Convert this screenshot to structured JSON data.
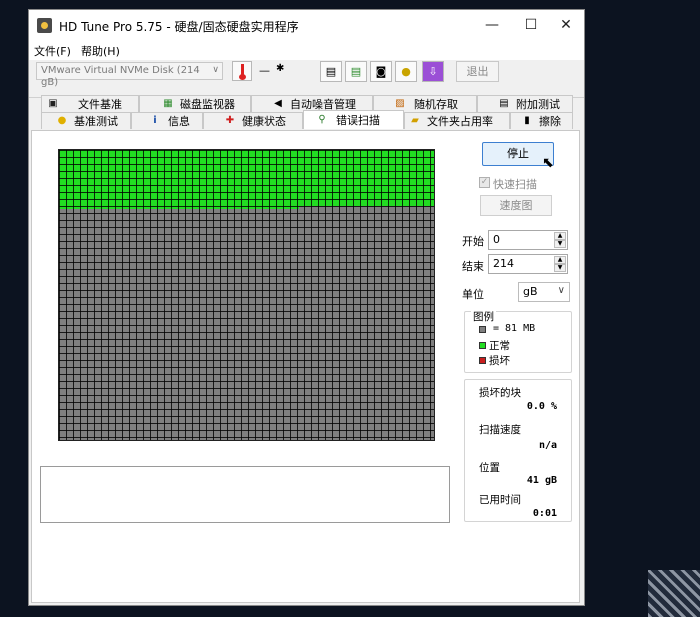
{
  "window": {
    "title": "HD Tune Pro 5.75 - 硬盘/固态硬盘实用程序",
    "minimize": "—",
    "maximize": "☐",
    "close": "✕"
  },
  "menu": [
    {
      "label": "文件(F)"
    },
    {
      "label": "帮助(H)"
    }
  ],
  "toolbar": {
    "disk": "VMware Virtual NVMe Disk (214 gB)",
    "temperature": "—",
    "exit_label": "退出",
    "icons": [
      "copy-icon",
      "copy-alt-icon",
      "camera-icon",
      "coins-icon",
      "download-icon"
    ]
  },
  "tabs_row1": [
    {
      "label": "文件基准",
      "icon": "file-benchmark-icon"
    },
    {
      "label": "磁盘监视器",
      "icon": "disk-monitor-icon"
    },
    {
      "label": "自动噪音管理",
      "icon": "speaker-icon"
    },
    {
      "label": "随机存取",
      "icon": "random-access-icon"
    },
    {
      "label": "附加测试",
      "icon": "extra-tests-icon"
    }
  ],
  "tabs_row2": [
    {
      "label": "基准测试",
      "icon": "lightbulb-icon"
    },
    {
      "label": "信息",
      "icon": "info-icon"
    },
    {
      "label": "健康状态",
      "icon": "health-cross-icon"
    },
    {
      "label": "错误扫描",
      "icon": "magnifier-icon"
    },
    {
      "label": "文件夹占用率",
      "icon": "folder-icon"
    },
    {
      "label": "擦除",
      "icon": "trash-icon"
    }
  ],
  "scan": {
    "stop_label": "停止",
    "quick_scan_label": "快速扫描",
    "quick_scan_checked": true,
    "speed_map_label": "速度图",
    "start_label": "开始",
    "start_value": "0",
    "end_label": "结束",
    "end_value": "214",
    "unit_label": "单位",
    "unit_value": "gB",
    "green_block_fraction": 0.19
  },
  "legend": {
    "title": "图例",
    "block_size": "= 81 MB",
    "ok": "正常",
    "damaged": "损坏",
    "colors": {
      "block": "#7f7f7f",
      "ok": "#22dd22",
      "damaged": "#c81e1e"
    }
  },
  "stats": {
    "damaged_blocks_label": "损坏的块",
    "damaged_blocks_value": "0.0 %",
    "scan_speed_label": "扫描速度",
    "scan_speed_value": "n/a",
    "position_label": "位置",
    "position_value": "41 gB",
    "elapsed_label": "已用时间",
    "elapsed_value": "0:01"
  }
}
